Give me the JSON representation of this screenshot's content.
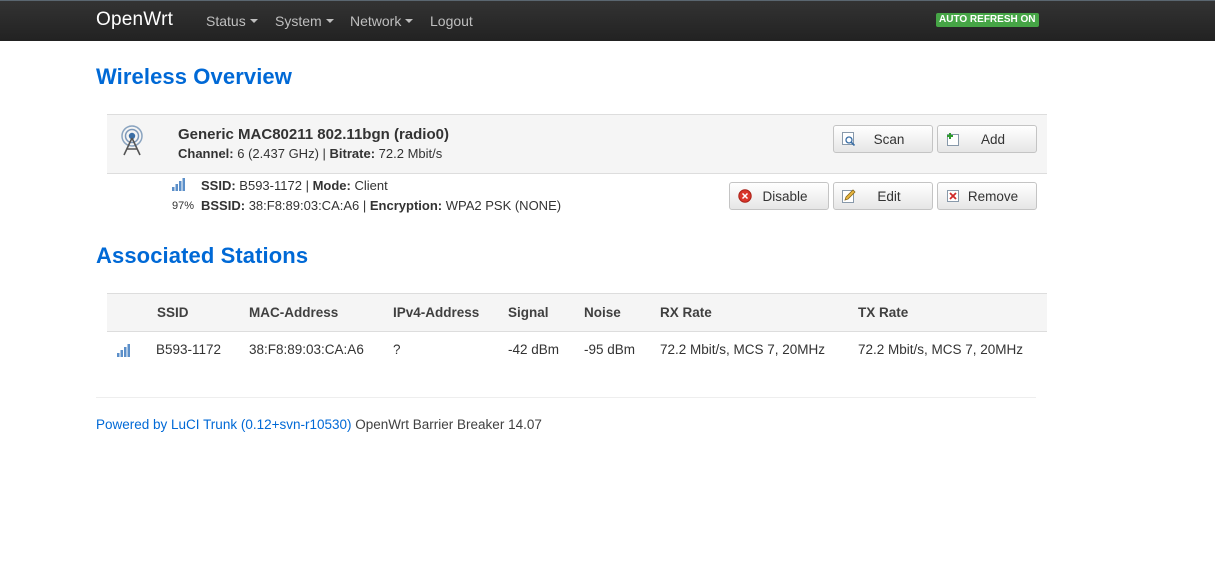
{
  "navbar": {
    "brand": "OpenWrt",
    "menu": [
      {
        "label": "Status",
        "dropdown": true
      },
      {
        "label": "System",
        "dropdown": true
      },
      {
        "label": "Network",
        "dropdown": true
      },
      {
        "label": "Logout",
        "dropdown": false
      }
    ],
    "auto_refresh": "AUTO REFRESH ON",
    "auto_refresh_color": "#46a546"
  },
  "wireless": {
    "heading": "Wireless Overview",
    "device": {
      "name": "Generic MAC80211 802.11bgn (radio0)",
      "channel_label": "Channel:",
      "channel_value": "6 (2.437 GHz)",
      "bitrate_label": "Bitrate:",
      "bitrate_value": "72.2 Mbit/s",
      "icon": "wifi-radio-icon",
      "buttons": {
        "scan": "Scan",
        "add": "Add"
      }
    },
    "network": {
      "signal_percent": "97%",
      "ssid_label": "SSID:",
      "ssid_value": "B593-1172",
      "mode_label": "Mode:",
      "mode_value": "Client",
      "bssid_label": "BSSID:",
      "bssid_value": "38:F8:89:03:CA:A6",
      "encryption_label": "Encryption:",
      "encryption_value": "WPA2 PSK (NONE)",
      "buttons": {
        "disable": "Disable",
        "edit": "Edit",
        "remove": "Remove"
      }
    }
  },
  "stations": {
    "heading": "Associated Stations",
    "columns": [
      "SSID",
      "MAC-Address",
      "IPv4-Address",
      "Signal",
      "Noise",
      "RX Rate",
      "TX Rate"
    ],
    "rows": [
      {
        "ssid": "B593-1172",
        "mac": "38:F8:89:03:CA:A6",
        "ipv4": "?",
        "signal": "-42 dBm",
        "noise": "-95 dBm",
        "rx_rate": "72.2 Mbit/s, MCS 7, 20MHz",
        "tx_rate": "72.2 Mbit/s, MCS 7, 20MHz"
      }
    ]
  },
  "footer": {
    "link_text": "Powered by LuCI Trunk (0.12+svn-r10530)",
    "version_text": " OpenWrt Barrier Breaker 14.07"
  },
  "colors": {
    "link": "#0069d6",
    "navbar": "#222222"
  }
}
